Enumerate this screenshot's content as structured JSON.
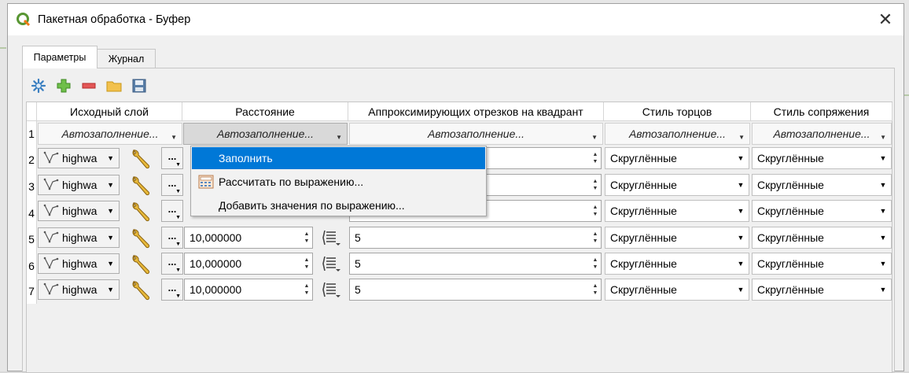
{
  "window": {
    "title": "Пакетная обработка - Буфер",
    "close_icon": "close-icon"
  },
  "tabs": [
    {
      "label": "Параметры",
      "active": true
    },
    {
      "label": "Журнал",
      "active": false
    }
  ],
  "toolbar": {
    "icons": [
      "settings-icon",
      "add-row-icon",
      "remove-row-icon",
      "open-folder-icon",
      "save-icon"
    ]
  },
  "table": {
    "headers": [
      "Исходный слой",
      "Расстояние",
      "Аппроксимирующих отрезков на квадрант",
      "Стиль торцов",
      "Стиль сопряжения"
    ],
    "autofill_label": "Автозаполнение...",
    "row_numbers": [
      "1",
      "2",
      "3",
      "4",
      "5",
      "6",
      "7"
    ],
    "layer_value": "highwa",
    "distance_value": "10,000000",
    "segments_value": "5",
    "end_cap_value": "Скруглённые",
    "join_value": "Скруглённые"
  },
  "context_menu": {
    "items": [
      {
        "label": "Заполнить",
        "selected": true
      },
      {
        "label": "Рассчитать по выражению...",
        "icon": "calculator-icon"
      },
      {
        "label": "Добавить значения по выражению...",
        "icon": "none"
      }
    ]
  },
  "colors": {
    "selection": "#0078d7",
    "window_bg": "#f0f0f0",
    "qgis_green": "#589632"
  }
}
